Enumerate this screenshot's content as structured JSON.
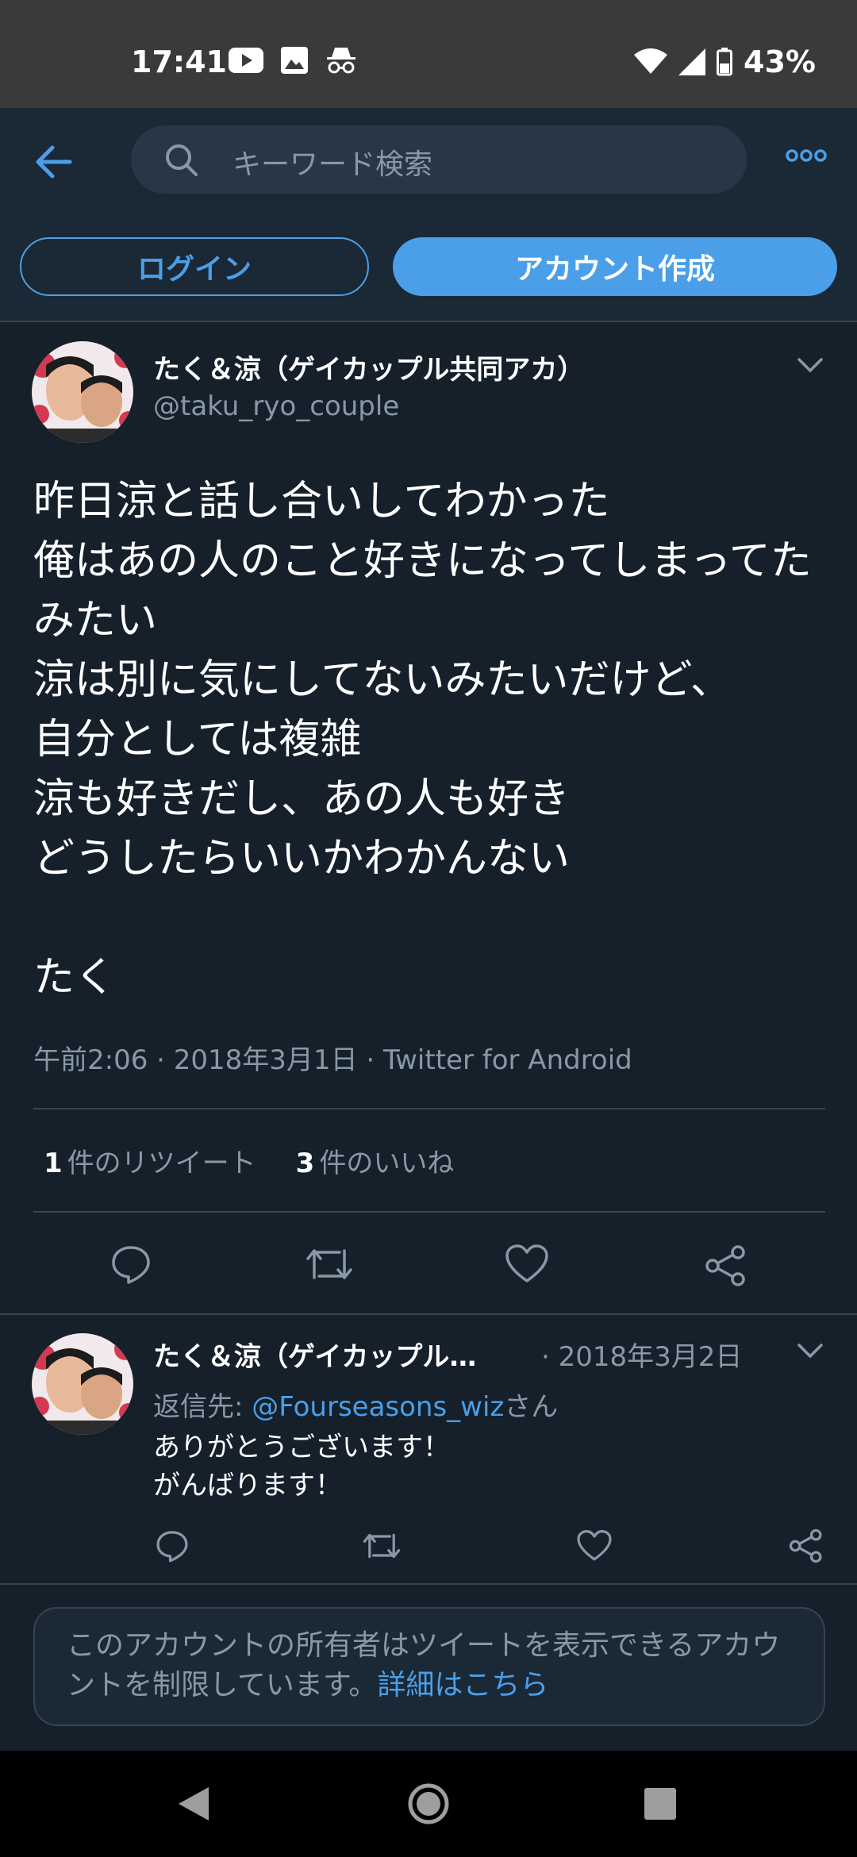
{
  "status_bar": {
    "time": "17:41",
    "battery": "43%",
    "icons": [
      "youtube-icon",
      "image-icon",
      "incognito-icon",
      "wifi-icon",
      "signal-icon",
      "battery-icon"
    ]
  },
  "topbar": {
    "search_placeholder": "キーワード検索"
  },
  "auth": {
    "login_label": "ログイン",
    "signup_label": "アカウント作成"
  },
  "tweet": {
    "display_name": "たく＆涼（ゲイカップル共同アカ）",
    "handle": "@taku_ryo_couple",
    "text": "昨日涼と話し合いしてわかった\n俺はあの人のこと好きになってしまってたみたい\n涼は別に気にしてないみたいだけど、\n自分としては複雑\n涼も好きだし、あの人も好き\nどうしたらいいかわかんない\n\nたく",
    "meta": "午前2:06 · 2018年3月1日 · Twitter for Android",
    "retweet_count": "1",
    "retweet_label": "件のリツイート",
    "like_count": "3",
    "like_label": "件のいいね"
  },
  "reply": {
    "display_name": "たく＆涼（ゲイカップル…",
    "date": "· 2018年3月2日",
    "reply_to_prefix": "返信先: ",
    "reply_to_handle": "@Fourseasons_wiz",
    "reply_to_suffix": "さん",
    "text": "ありがとうございます！\nがんばります！"
  },
  "notice": {
    "text": "このアカウントの所有者はツイートを表示できるアカウントを制限しています。",
    "link": "詳細はこちら"
  },
  "colors": {
    "background": "#15202b",
    "accent": "#4a9fe8",
    "muted": "#8899a6",
    "divider": "#38444d"
  }
}
